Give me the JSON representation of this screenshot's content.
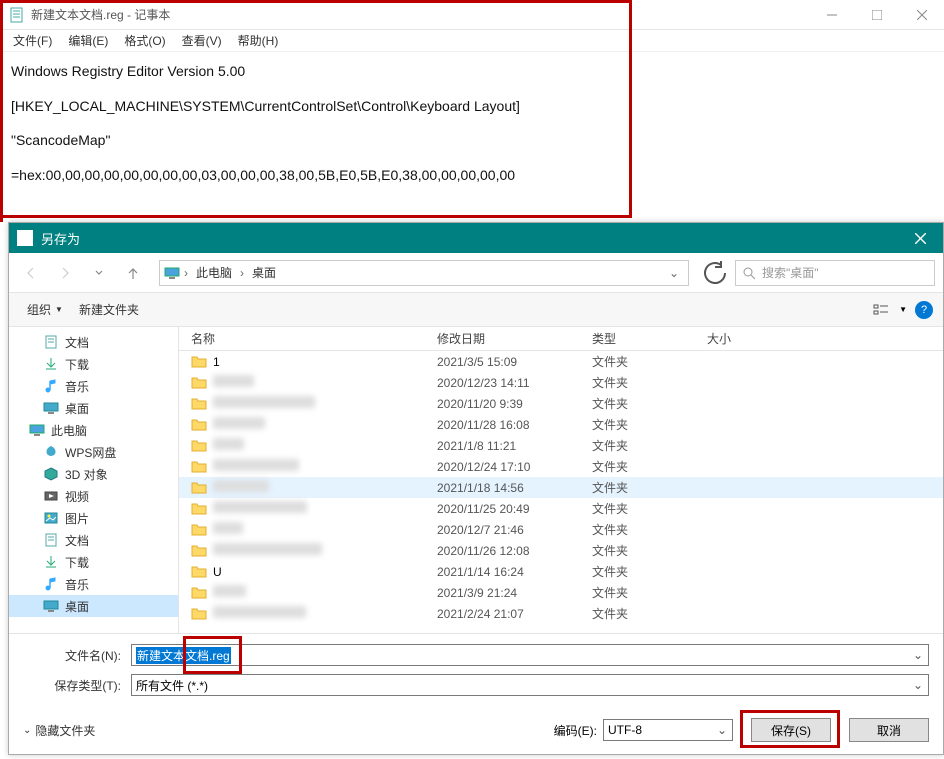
{
  "notepad": {
    "title": "新建文本文档.reg - 记事本",
    "menu": {
      "file": "文件(F)",
      "edit": "编辑(E)",
      "format": "格式(O)",
      "view": "查看(V)",
      "help": "帮助(H)"
    },
    "content": {
      "line1": "Windows Registry Editor Version 5.00",
      "line2": "[HKEY_LOCAL_MACHINE\\SYSTEM\\CurrentControlSet\\Control\\Keyboard Layout]",
      "line3": "\"ScancodeMap\"",
      "line4": "=hex:00,00,00,00,00,00,00,00,03,00,00,00,38,00,5B,E0,5B,E0,38,00,00,00,00,00"
    }
  },
  "dialog": {
    "title": "另存为",
    "breadcrumb": {
      "pc": "此电脑",
      "desktop": "桌面"
    },
    "search_placeholder": "搜索\"桌面\"",
    "toolbar": {
      "organize": "组织",
      "newfolder": "新建文件夹"
    },
    "columns": {
      "name": "名称",
      "date": "修改日期",
      "type": "类型",
      "size": "大小"
    },
    "sidebar": [
      {
        "label": "文档",
        "icon": "doc",
        "level": 2
      },
      {
        "label": "下载",
        "icon": "download",
        "level": 2
      },
      {
        "label": "音乐",
        "icon": "music",
        "level": 2
      },
      {
        "label": "桌面",
        "icon": "desktop",
        "level": 2
      },
      {
        "label": "此电脑",
        "icon": "pc",
        "level": 1
      },
      {
        "label": "WPS网盘",
        "icon": "wps",
        "level": 2
      },
      {
        "label": "3D 对象",
        "icon": "3d",
        "level": 2
      },
      {
        "label": "视频",
        "icon": "video",
        "level": 2
      },
      {
        "label": "图片",
        "icon": "image",
        "level": 2
      },
      {
        "label": "文档",
        "icon": "doc",
        "level": 2
      },
      {
        "label": "下载",
        "icon": "download",
        "level": 2
      },
      {
        "label": "音乐",
        "icon": "music",
        "level": 2
      },
      {
        "label": "桌面",
        "icon": "desktop",
        "level": 2,
        "selected": true
      }
    ],
    "rows": [
      {
        "name": "1",
        "date": "2021/3/5 15:09",
        "type": "文件夹"
      },
      {
        "name": "",
        "date": "2020/12/23 14:11",
        "type": "文件夹"
      },
      {
        "name": "",
        "date": "2020/11/20 9:39",
        "type": "文件夹"
      },
      {
        "name": "",
        "date": "2020/11/28 16:08",
        "type": "文件夹"
      },
      {
        "name": "",
        "date": "2021/1/8 11:21",
        "type": "文件夹"
      },
      {
        "name": "",
        "date": "2020/12/24 17:10",
        "type": "文件夹"
      },
      {
        "name": "",
        "date": "2021/1/18 14:56",
        "type": "文件夹",
        "hover": true
      },
      {
        "name": "",
        "date": "2020/11/25 20:49",
        "type": "文件夹"
      },
      {
        "name": "",
        "date": "2020/12/7 21:46",
        "type": "文件夹"
      },
      {
        "name": "",
        "date": "2020/11/26 12:08",
        "type": "文件夹"
      },
      {
        "name": "U",
        "date": "2021/1/14 16:24",
        "type": "文件夹"
      },
      {
        "name": "",
        "date": "2021/3/9 21:24",
        "type": "文件夹"
      },
      {
        "name": "",
        "date": "2021/2/24 21:07",
        "type": "文件夹"
      }
    ],
    "filename_label": "文件名(N):",
    "filename_value": "新建文本文档.reg",
    "filetype_label": "保存类型(T):",
    "filetype_value": "所有文件 (*.*)",
    "hide_folders": "隐藏文件夹",
    "encoding_label": "编码(E):",
    "encoding_value": "UTF-8",
    "save_btn": "保存(S)",
    "cancel_btn": "取消"
  }
}
